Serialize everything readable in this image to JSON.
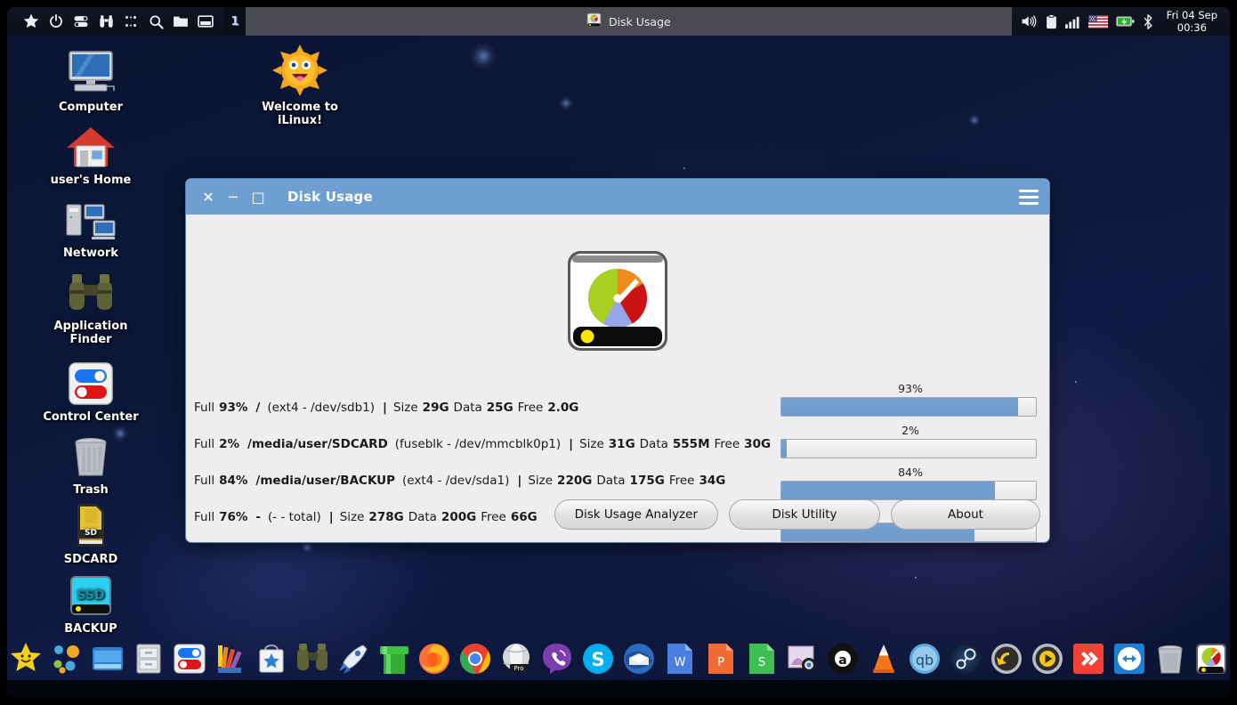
{
  "panel": {
    "launchers": [
      {
        "name": "star-icon",
        "label": "Favorites"
      },
      {
        "name": "power-icon",
        "label": "Power"
      },
      {
        "name": "toggle-switch-icon",
        "label": "Settings"
      },
      {
        "name": "binoculars-icon",
        "label": "Finder"
      },
      {
        "name": "grid-dots-icon",
        "label": "Applications"
      },
      {
        "name": "search-icon",
        "label": "Search"
      },
      {
        "name": "folder-icon",
        "label": "Files"
      },
      {
        "name": "window-icon",
        "label": "Windows"
      }
    ],
    "workspace": "1",
    "task": {
      "title": "Disk Usage",
      "icon": "disk-usage-icon"
    },
    "tray": [
      {
        "name": "volume-icon",
        "label": "Volume"
      },
      {
        "name": "clipboard-icon",
        "label": "Clipboard"
      },
      {
        "name": "signal-icon",
        "label": "Network signal"
      },
      {
        "name": "flag-us-icon",
        "label": "Keyboard layout: US"
      },
      {
        "name": "battery-charging-icon",
        "label": "Battery"
      },
      {
        "name": "bluetooth-icon",
        "label": "Bluetooth"
      }
    ],
    "clock": {
      "date": "Fri 04 Sep",
      "time": "00:36"
    }
  },
  "desktop": {
    "icons": [
      {
        "name": "desktop-icon-computer",
        "label": "Computer",
        "icon": "computer-icon"
      },
      {
        "name": "desktop-icon-home",
        "label": "user's Home",
        "icon": "home-icon"
      },
      {
        "name": "desktop-icon-network",
        "label": "Network",
        "icon": "network-icon"
      },
      {
        "name": "desktop-icon-application-finder",
        "label": "Application Finder",
        "icon": "binoculars-icon"
      },
      {
        "name": "desktop-icon-control-center",
        "label": "Control Center",
        "icon": "toggle-switch-icon"
      },
      {
        "name": "desktop-icon-trash",
        "label": "Trash",
        "icon": "trash-icon"
      },
      {
        "name": "desktop-icon-sdcard",
        "label": "SDCARD",
        "icon": "sdcard-icon"
      },
      {
        "name": "desktop-icon-backup",
        "label": "BACKUP",
        "icon": "ssd-icon"
      }
    ],
    "welcome": {
      "label_line1": "Welcome to",
      "label_line2": "iLinux!",
      "icon": "sun-icon"
    }
  },
  "dialog": {
    "title": "Disk Usage",
    "titlebar_color": "#6f9fd1",
    "close_label": "✕",
    "minimize_label": "─",
    "maximize_label": "□",
    "menu_label": "menu",
    "app_icon": "disk-usage-gauge-icon",
    "rows": [
      {
        "full_label": "Full",
        "percent": "93%",
        "mount": "/",
        "device": "(ext4 - /dev/sdb1)",
        "separator": "|",
        "size_label": "Size",
        "size": "29G",
        "data_label": "Data",
        "data": "25G",
        "free_label": "Free",
        "free": "2.0G"
      },
      {
        "full_label": "Full",
        "percent": "2%",
        "mount": "/media/user/SDCARD",
        "device": "(fuseblk - /dev/mmcblk0p1)",
        "separator": "|",
        "size_label": "Size",
        "size": "31G",
        "data_label": "Data",
        "data": "555M",
        "free_label": "Free",
        "free": "30G"
      },
      {
        "full_label": "Full",
        "percent": "84%",
        "mount": "/media/user/BACKUP",
        "device": "(ext4 - /dev/sda1)",
        "separator": "|",
        "size_label": "Size",
        "size": "220G",
        "data_label": "Data",
        "data": "175G",
        "free_label": "Free",
        "free": "34G"
      },
      {
        "full_label": "Full",
        "percent": "76%",
        "mount": "-",
        "device": "(- - total)",
        "separator": "|",
        "size_label": "Size",
        "size": "278G",
        "data_label": "Data",
        "data": "200G",
        "free_label": "Free",
        "free": "66G"
      }
    ],
    "bars": [
      {
        "label": "93%",
        "value": 93
      },
      {
        "label": "2%",
        "value": 2
      },
      {
        "label": "84%",
        "value": 84
      },
      {
        "label": "76%",
        "value": 76
      }
    ],
    "bar_fill_color": "#73a0d0",
    "buttons": [
      {
        "name": "disk-usage-analyzer-button",
        "label": "Disk Usage Analyzer"
      },
      {
        "name": "disk-utility-button",
        "label": "Disk Utility"
      },
      {
        "name": "about-button",
        "label": "About"
      }
    ]
  },
  "dock": {
    "items": [
      {
        "name": "dock-item-star",
        "label": "Star Menu",
        "icon": "star-smile-icon"
      },
      {
        "name": "dock-item-apps",
        "label": "Applications",
        "icon": "dots-circle-icon"
      },
      {
        "name": "dock-item-file-manager",
        "label": "File Manager",
        "icon": "window-blue-icon"
      },
      {
        "name": "dock-item-archive",
        "label": "Archive Manager",
        "icon": "cabinet-icon"
      },
      {
        "name": "dock-item-control-center",
        "label": "Control Center",
        "icon": "toggle-switch-icon"
      },
      {
        "name": "dock-item-theme",
        "label": "Appearance",
        "icon": "palette-icon"
      },
      {
        "name": "dock-item-store",
        "label": "Software Store",
        "icon": "shopping-bag-star-icon"
      },
      {
        "name": "dock-item-finder",
        "label": "Application Finder",
        "icon": "binoculars-icon"
      },
      {
        "name": "dock-item-rocket",
        "label": "Launcher",
        "icon": "rocket-icon"
      },
      {
        "name": "dock-item-pipe",
        "label": "Game",
        "icon": "green-pipe-icon"
      },
      {
        "name": "dock-item-firefox",
        "label": "Firefox",
        "icon": "firefox-icon"
      },
      {
        "name": "dock-item-chrome",
        "label": "Google Chrome",
        "icon": "chrome-icon"
      },
      {
        "name": "dock-item-opera",
        "label": "Opera Pro",
        "icon": "opera-pro-icon"
      },
      {
        "name": "dock-item-viber",
        "label": "Viber",
        "icon": "viber-icon"
      },
      {
        "name": "dock-item-skype",
        "label": "Skype",
        "icon": "skype-icon"
      },
      {
        "name": "dock-item-thunderbird",
        "label": "Thunderbird",
        "icon": "thunderbird-icon"
      },
      {
        "name": "dock-item-writer",
        "label": "Writer",
        "icon": "writer-w-icon"
      },
      {
        "name": "dock-item-impress",
        "label": "Presentation",
        "icon": "presentation-p-icon"
      },
      {
        "name": "dock-item-calc",
        "label": "Spreadsheet",
        "icon": "spreadsheet-s-icon"
      },
      {
        "name": "dock-item-camera",
        "label": "Webcam",
        "icon": "webcam-icon"
      },
      {
        "name": "dock-item-audacity",
        "label": "Audacity",
        "icon": "audacity-a-icon"
      },
      {
        "name": "dock-item-vlc",
        "label": "VLC",
        "icon": "vlc-cone-icon"
      },
      {
        "name": "dock-item-qbittorrent",
        "label": "qBittorrent",
        "icon": "qbittorrent-icon"
      },
      {
        "name": "dock-item-steam",
        "label": "Steam",
        "icon": "steam-icon"
      },
      {
        "name": "dock-item-undo",
        "label": "Restore",
        "icon": "undo-arrow-icon"
      },
      {
        "name": "dock-item-play",
        "label": "Media Player",
        "icon": "play-circle-icon"
      },
      {
        "name": "dock-item-anydesk",
        "label": "AnyDesk",
        "icon": "anydesk-icon"
      },
      {
        "name": "dock-item-teamviewer",
        "label": "TeamViewer",
        "icon": "teamviewer-icon"
      },
      {
        "name": "dock-item-trash",
        "label": "Trash",
        "icon": "trash-icon"
      },
      {
        "name": "dock-item-disk-usage",
        "label": "Disk Usage",
        "icon": "disk-usage-icon"
      }
    ]
  }
}
